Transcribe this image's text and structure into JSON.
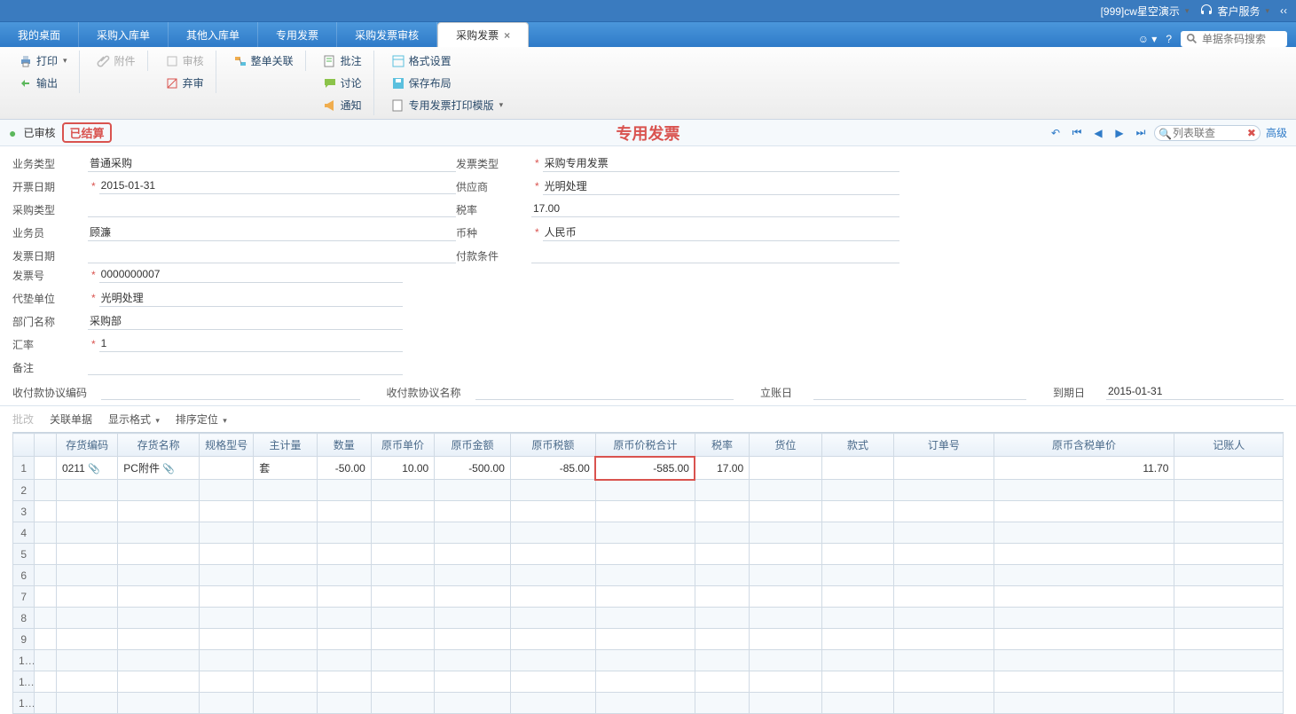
{
  "topmenu": {
    "ws": "[999]cw星空演示",
    "service": "客户服务"
  },
  "tabs": [
    "我的桌面",
    "采购入库单",
    "其他入库单",
    "专用发票",
    "采购发票审核",
    "采购发票"
  ],
  "active_tab": 5,
  "tab_search_placeholder": "单据条码搜索",
  "toolbar": {
    "print": "打印",
    "attach": "附件",
    "audit": "审核",
    "export": "输出",
    "reject": "弃审",
    "link": "整单关联",
    "batch": "批注",
    "discuss": "讨论",
    "notify": "通知",
    "format": "格式设置",
    "save_layout": "保存布局",
    "template": "专用发票打印模版"
  },
  "status": {
    "audited": "已审核",
    "stamp": "已结算",
    "title": "专用发票",
    "search_label": "列表联查",
    "advanced": "高级"
  },
  "form": {
    "biz_type_l": "业务类型",
    "biz_type_v": "普通采购",
    "date_l": "开票日期",
    "date_v": "2015-01-31",
    "purch_l": "采购类型",
    "clerk_l": "业务员",
    "clerk_v": "顾濂",
    "inv_date_l": "发票日期",
    "proto_code_l": "收付款协议编码",
    "inv_type_l": "发票类型",
    "inv_type_v": "采购专用发票",
    "supplier_l": "供应商",
    "supplier_v": "光明处理",
    "tax_l": "税率",
    "tax_v": "17.00",
    "curr_l": "币种",
    "curr_v": "人民币",
    "pay_l": "付款条件",
    "proto_name_l": "收付款协议名称",
    "inv_no_l": "发票号",
    "inv_no_v": "0000000007",
    "replace_l": "代垫单位",
    "replace_v": "光明处理",
    "dept_l": "部门名称",
    "dept_v": "采购部",
    "rate_l": "汇率",
    "rate_v": "1",
    "remark_l": "备注",
    "acct_date_l": "立账日",
    "due_l": "到期日",
    "due_v": "2015-01-31"
  },
  "gridbar": {
    "batch": "批改",
    "link": "关联单据",
    "display": "显示格式",
    "sort": "排序定位"
  },
  "columns": [
    "",
    "存货编码",
    "存货名称",
    "规格型号",
    "主计量",
    "数量",
    "原币单价",
    "原币金额",
    "原币税额",
    "原币价税合计",
    "税率",
    "货位",
    "款式",
    "订单号",
    "原币含税单价",
    "记账人"
  ],
  "rows": [
    {
      "n": 1,
      "code": "0211",
      "clip": true,
      "name": "PC附件",
      "nclip": true,
      "spec": "",
      "unit": "套",
      "qty": "-50.00",
      "price": "10.00",
      "amt": "-500.00",
      "tax": "-85.00",
      "total": "-585.00",
      "rate": "17.00",
      "loc": "",
      "style": "",
      "order": "",
      "taxprice": "11.70",
      "acct": ""
    }
  ],
  "blank_rows": 11,
  "highlight_cell": {
    "row": 0,
    "col": "total"
  }
}
